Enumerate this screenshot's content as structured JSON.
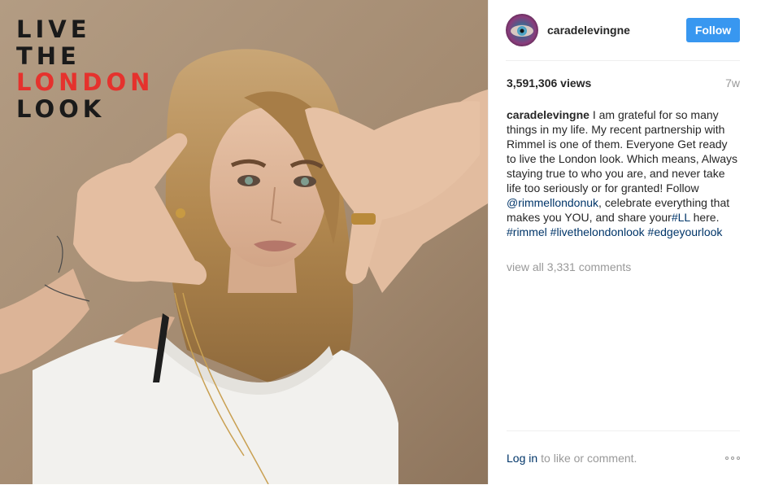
{
  "post": {
    "media": {
      "alt": "Photo",
      "overlay_lines": [
        "LIVE",
        "THE",
        "LONDON",
        "LOOK"
      ],
      "accent_color": "#e5322d"
    },
    "header": {
      "username": "caradelevingne",
      "follow_label": "Follow",
      "follow_color": "#3897f0"
    },
    "stats": {
      "views": "3,591,306 views",
      "time_ago": "7w"
    },
    "caption": {
      "author": "caradelevingne",
      "text_1": " I am grateful for so many things in my life. My recent partnership with Rimmel is one of them. Everyone Get ready to live the London look. Which means, Always staying true to who you are, and never take life too seriously or for granted! Follow ",
      "mention": "@rimmellondonuk",
      "text_2": ", celebrate everything that makes you YOU, and share your",
      "tag_ll": "#LL",
      "text_3": " here. ",
      "tag_rimmel": "#rimmel",
      "tag_live": "#livethelondonlook",
      "tag_edge": "#edgeyourlook"
    },
    "comments_link": "view all 3,331 comments",
    "footer": {
      "login_label": "Log in",
      "rest_text": "to like or comment."
    },
    "link_color": "#003569"
  }
}
